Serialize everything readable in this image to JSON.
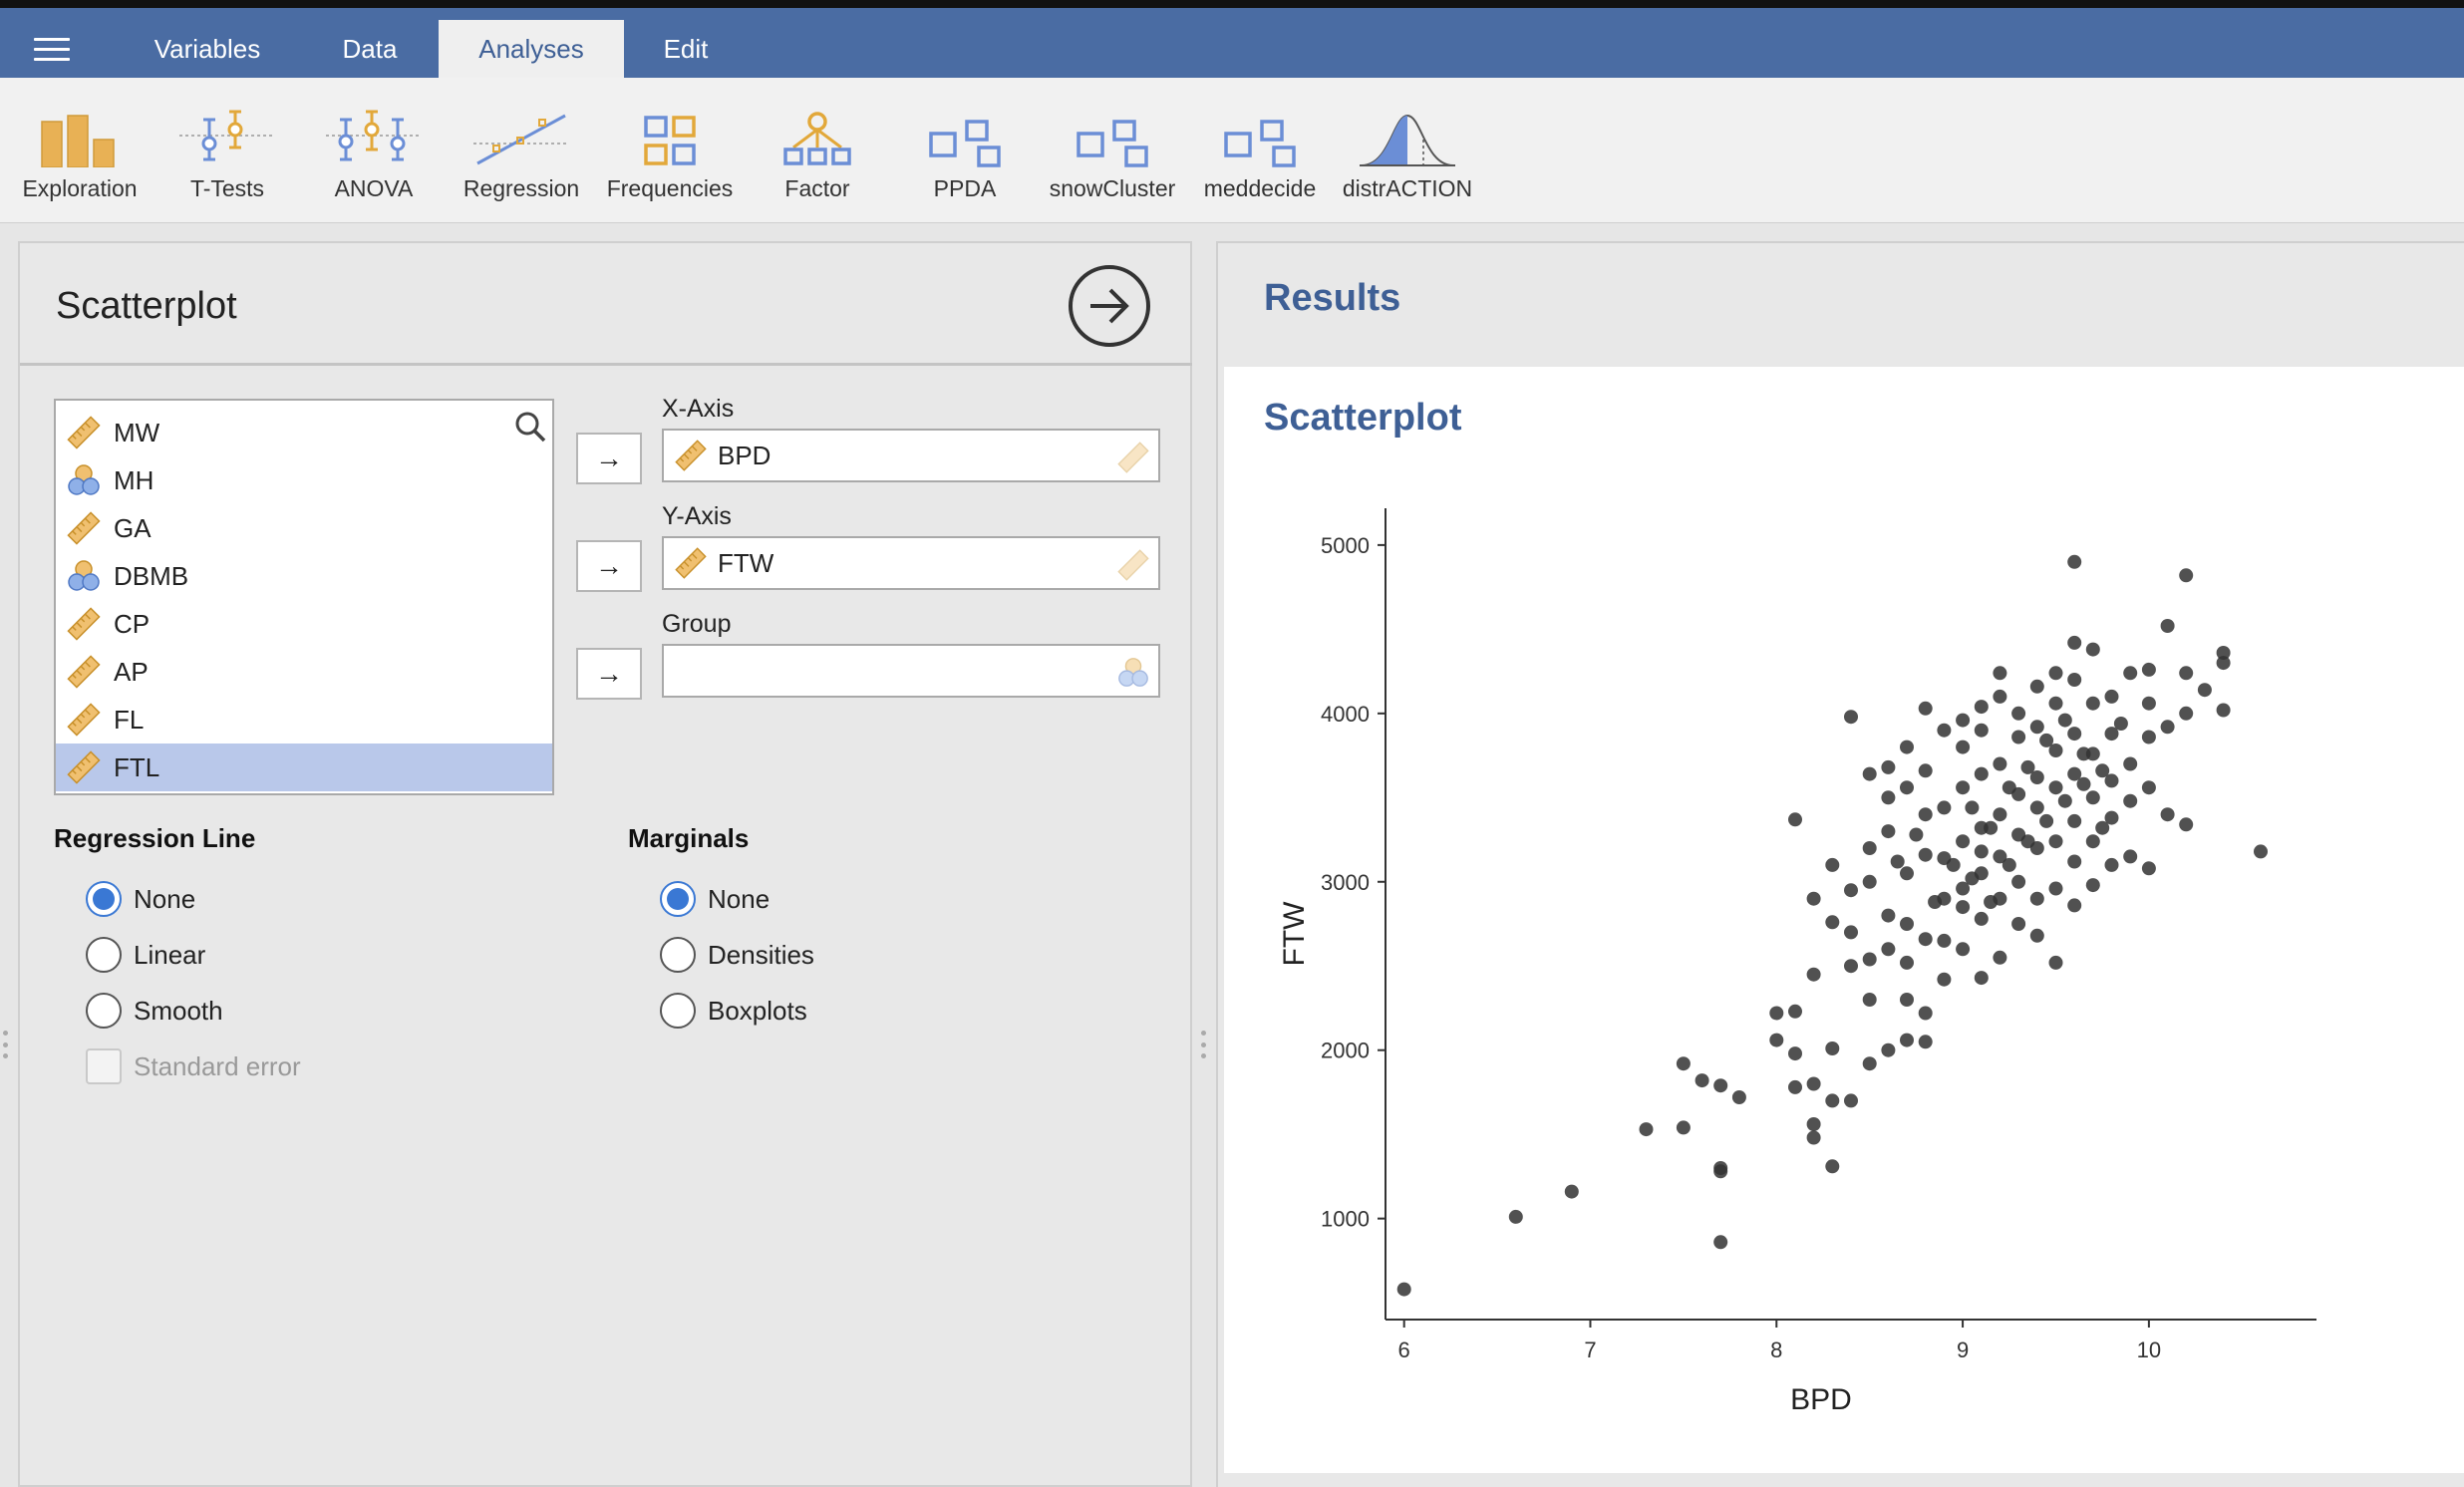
{
  "tabs": [
    {
      "label": "Variables"
    },
    {
      "label": "Data"
    },
    {
      "label": "Analyses"
    },
    {
      "label": "Edit"
    }
  ],
  "ribbon": {
    "modules": [
      {
        "label": "Exploration",
        "icon": "exploration-icon"
      },
      {
        "label": "T-Tests",
        "icon": "ttests-icon"
      },
      {
        "label": "ANOVA",
        "icon": "anova-icon"
      },
      {
        "label": "Regression",
        "icon": "regression-icon"
      },
      {
        "label": "Frequencies",
        "icon": "frequencies-icon"
      },
      {
        "label": "Factor",
        "icon": "factor-icon"
      },
      {
        "label": "PPDA",
        "icon": "module-icon"
      },
      {
        "label": "snowCluster",
        "icon": "module-icon"
      },
      {
        "label": "meddecide",
        "icon": "module-icon"
      },
      {
        "label": "distrACTION",
        "icon": "distribution-icon"
      }
    ]
  },
  "options": {
    "title": "Scatterplot",
    "variables": [
      {
        "name": "MW",
        "type": "continuous"
      },
      {
        "name": "MH",
        "type": "nominal"
      },
      {
        "name": "GA",
        "type": "continuous"
      },
      {
        "name": "DBMB",
        "type": "nominal"
      },
      {
        "name": "CP",
        "type": "continuous"
      },
      {
        "name": "AP",
        "type": "continuous"
      },
      {
        "name": "FL",
        "type": "continuous"
      },
      {
        "name": "FTL",
        "type": "continuous",
        "selected": true
      }
    ],
    "x_axis": {
      "label": "X-Axis",
      "value": "BPD"
    },
    "y_axis": {
      "label": "Y-Axis",
      "value": "FTW"
    },
    "group": {
      "label": "Group",
      "value": ""
    },
    "regression_line": {
      "label": "Regression Line",
      "options": [
        "None",
        "Linear",
        "Smooth"
      ],
      "selected": "None",
      "standard_error": "Standard error"
    },
    "marginals": {
      "label": "Marginals",
      "options": [
        "None",
        "Densities",
        "Boxplots"
      ],
      "selected": "None"
    }
  },
  "results": {
    "title": "Results",
    "card_title": "Scatterplot"
  },
  "colors": {
    "header": "#4a6ca3",
    "accent": "#3e5f95",
    "radio": "#3a78d4",
    "point": "#333333"
  },
  "chart_data": {
    "type": "scatter",
    "xlabel": "BPD",
    "ylabel": "FTW",
    "xlim": [
      5.9,
      10.9
    ],
    "ylim": [
      400,
      5100
    ],
    "xticks": [
      6,
      7,
      8,
      9,
      10
    ],
    "yticks": [
      1000,
      2000,
      3000,
      4000,
      5000
    ],
    "points": [
      [
        6.0,
        580
      ],
      [
        6.6,
        1010
      ],
      [
        6.9,
        1160
      ],
      [
        7.3,
        1530
      ],
      [
        7.5,
        1540
      ],
      [
        7.5,
        1920
      ],
      [
        7.6,
        1820
      ],
      [
        7.7,
        1790
      ],
      [
        7.7,
        1300
      ],
      [
        7.7,
        1280
      ],
      [
        7.7,
        860
      ],
      [
        7.8,
        1720
      ],
      [
        8.0,
        2220
      ],
      [
        8.0,
        2060
      ],
      [
        8.1,
        2230
      ],
      [
        8.1,
        1980
      ],
      [
        8.1,
        1780
      ],
      [
        8.1,
        3370
      ],
      [
        8.2,
        1800
      ],
      [
        8.2,
        1560
      ],
      [
        8.2,
        1480
      ],
      [
        8.2,
        2450
      ],
      [
        8.2,
        2900
      ],
      [
        8.3,
        1700
      ],
      [
        8.3,
        1310
      ],
      [
        8.3,
        2010
      ],
      [
        8.3,
        3100
      ],
      [
        8.3,
        2760
      ],
      [
        8.4,
        3980
      ],
      [
        8.4,
        2700
      ],
      [
        8.4,
        2500
      ],
      [
        8.4,
        1700
      ],
      [
        8.4,
        2950
      ],
      [
        8.5,
        3200
      ],
      [
        8.5,
        3640
      ],
      [
        8.5,
        2540
      ],
      [
        8.5,
        1920
      ],
      [
        8.5,
        2300
      ],
      [
        8.5,
        3000
      ],
      [
        8.6,
        2000
      ],
      [
        8.6,
        2600
      ],
      [
        8.6,
        2800
      ],
      [
        8.6,
        3300
      ],
      [
        8.6,
        3500
      ],
      [
        8.6,
        3680
      ],
      [
        8.7,
        2060
      ],
      [
        8.7,
        2520
      ],
      [
        8.7,
        3050
      ],
      [
        8.7,
        3560
      ],
      [
        8.7,
        3800
      ],
      [
        8.7,
        2750
      ],
      [
        8.7,
        2300
      ],
      [
        8.8,
        2220
      ],
      [
        8.8,
        2050
      ],
      [
        8.8,
        2660
      ],
      [
        8.8,
        3160
      ],
      [
        8.8,
        3400
      ],
      [
        8.8,
        3660
      ],
      [
        8.8,
        4030
      ],
      [
        8.9,
        3900
      ],
      [
        8.9,
        3440
      ],
      [
        8.9,
        3140
      ],
      [
        8.9,
        2900
      ],
      [
        8.9,
        2650
      ],
      [
        8.9,
        2420
      ],
      [
        9.0,
        2600
      ],
      [
        9.0,
        2960
      ],
      [
        9.0,
        3240
      ],
      [
        9.0,
        3560
      ],
      [
        9.0,
        3800
      ],
      [
        9.0,
        3960
      ],
      [
        9.0,
        2850
      ],
      [
        9.1,
        2430
      ],
      [
        9.1,
        2780
      ],
      [
        9.1,
        3050
      ],
      [
        9.1,
        3320
      ],
      [
        9.1,
        3640
      ],
      [
        9.1,
        4040
      ],
      [
        9.1,
        3900
      ],
      [
        9.1,
        3180
      ],
      [
        9.2,
        2550
      ],
      [
        9.2,
        2900
      ],
      [
        9.2,
        3150
      ],
      [
        9.2,
        3400
      ],
      [
        9.2,
        3700
      ],
      [
        9.2,
        4100
      ],
      [
        9.2,
        4240
      ],
      [
        9.3,
        2750
      ],
      [
        9.3,
        3000
      ],
      [
        9.3,
        3280
      ],
      [
        9.3,
        3520
      ],
      [
        9.3,
        3860
      ],
      [
        9.3,
        4000
      ],
      [
        9.4,
        2680
      ],
      [
        9.4,
        2900
      ],
      [
        9.4,
        3200
      ],
      [
        9.4,
        3440
      ],
      [
        9.4,
        3620
      ],
      [
        9.4,
        3920
      ],
      [
        9.4,
        4160
      ],
      [
        9.5,
        2520
      ],
      [
        9.5,
        2960
      ],
      [
        9.5,
        3240
      ],
      [
        9.5,
        3560
      ],
      [
        9.5,
        3780
      ],
      [
        9.5,
        4060
      ],
      [
        9.5,
        4240
      ],
      [
        9.6,
        2860
      ],
      [
        9.6,
        3120
      ],
      [
        9.6,
        3360
      ],
      [
        9.6,
        3640
      ],
      [
        9.6,
        3880
      ],
      [
        9.6,
        4200
      ],
      [
        9.6,
        4420
      ],
      [
        9.6,
        4900
      ],
      [
        9.7,
        2980
      ],
      [
        9.7,
        3240
      ],
      [
        9.7,
        3500
      ],
      [
        9.7,
        3760
      ],
      [
        9.7,
        4060
      ],
      [
        9.7,
        4380
      ],
      [
        9.8,
        3100
      ],
      [
        9.8,
        3380
      ],
      [
        9.8,
        3600
      ],
      [
        9.8,
        3880
      ],
      [
        9.8,
        4100
      ],
      [
        9.9,
        3150
      ],
      [
        9.9,
        3480
      ],
      [
        9.9,
        3700
      ],
      [
        9.9,
        4240
      ],
      [
        10.0,
        3080
      ],
      [
        10.0,
        3560
      ],
      [
        10.0,
        3860
      ],
      [
        10.0,
        4060
      ],
      [
        10.0,
        4260
      ],
      [
        10.1,
        3400
      ],
      [
        10.1,
        3920
      ],
      [
        10.2,
        3340
      ],
      [
        10.2,
        4000
      ],
      [
        10.2,
        4820
      ],
      [
        10.2,
        4240
      ],
      [
        10.1,
        4520
      ],
      [
        10.3,
        4140
      ],
      [
        10.4,
        4360
      ],
      [
        10.4,
        4300
      ],
      [
        10.4,
        4020
      ],
      [
        10.6,
        3180
      ],
      [
        9.05,
        3020
      ],
      [
        9.15,
        3320
      ],
      [
        9.25,
        3100
      ],
      [
        9.35,
        3240
      ],
      [
        9.45,
        3360
      ],
      [
        9.55,
        3480
      ],
      [
        9.65,
        3580
      ],
      [
        8.95,
        3100
      ],
      [
        9.05,
        3440
      ],
      [
        9.15,
        2880
      ],
      [
        9.25,
        3560
      ],
      [
        9.35,
        3680
      ],
      [
        9.45,
        3840
      ],
      [
        9.55,
        3960
      ],
      [
        9.65,
        3760
      ],
      [
        8.85,
        2880
      ],
      [
        8.75,
        3280
      ],
      [
        8.65,
        3120
      ],
      [
        9.75,
        3660
      ],
      [
        9.85,
        3940
      ],
      [
        9.75,
        3320
      ]
    ]
  }
}
